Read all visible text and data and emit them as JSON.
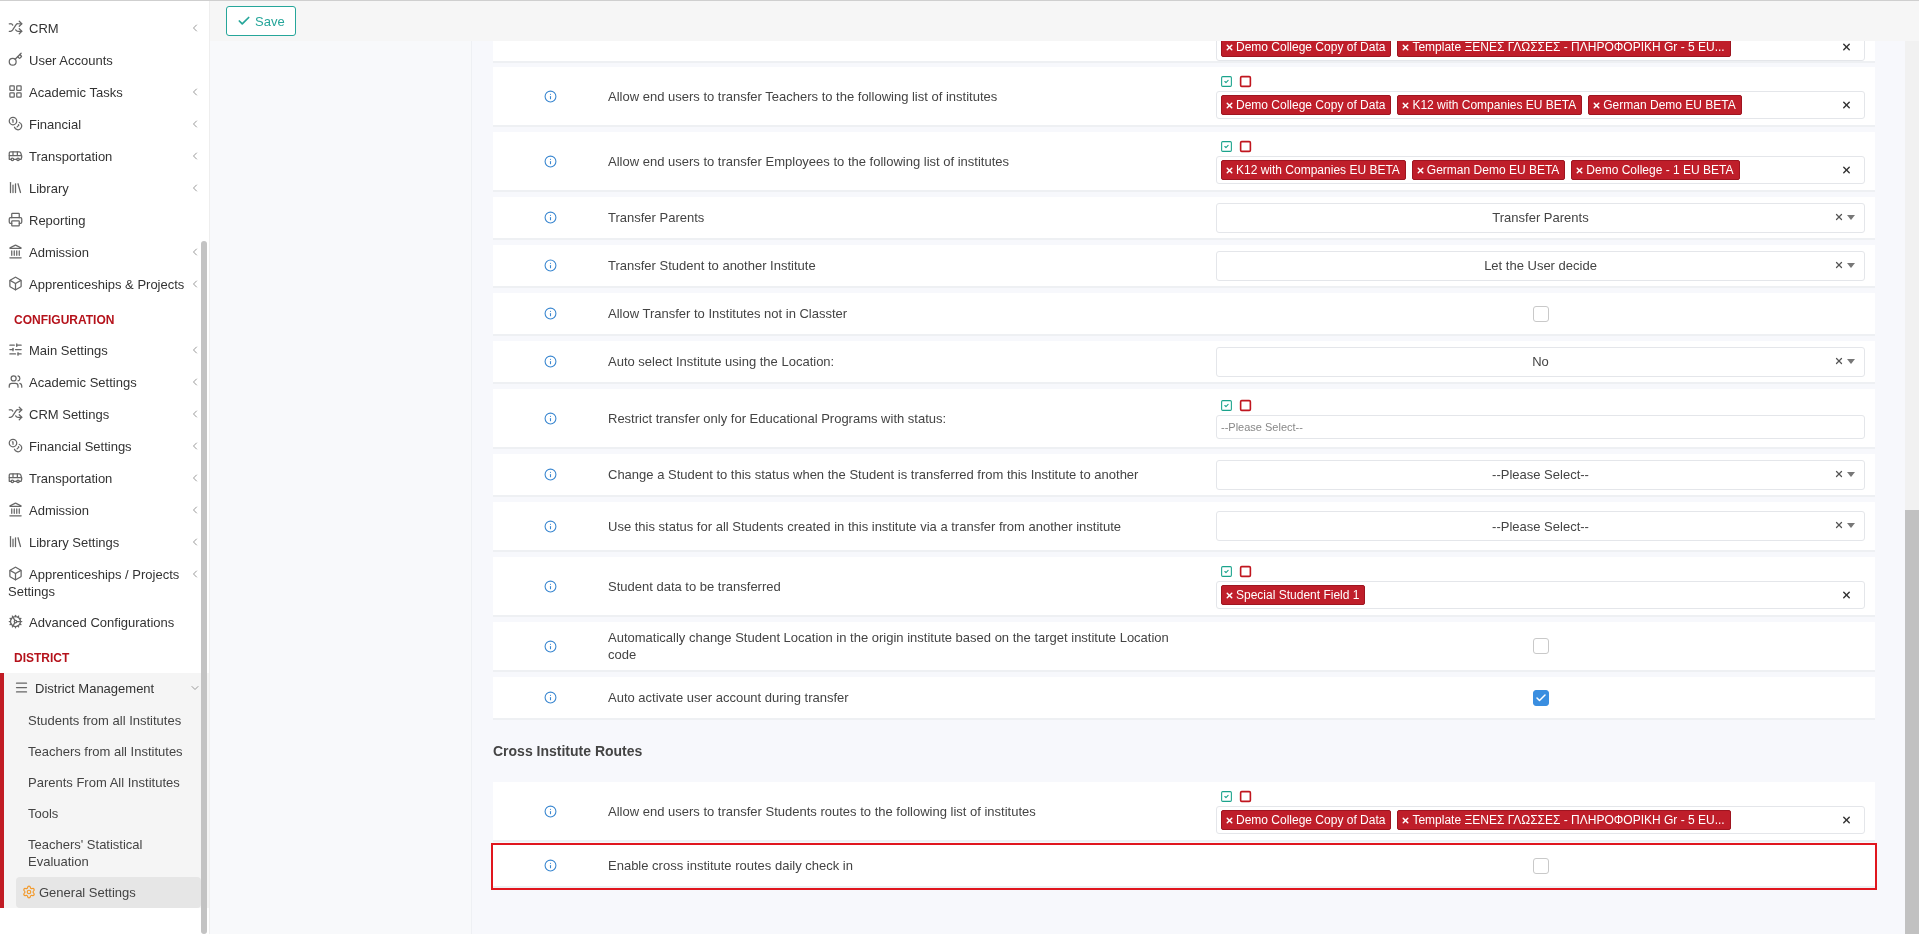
{
  "top_bar": {
    "save_label": "Save"
  },
  "sidebar": {
    "items": [
      {
        "kind": "item",
        "label": "CRM",
        "has_submenu": true
      },
      {
        "kind": "item",
        "label": "User Accounts",
        "has_submenu": false
      },
      {
        "kind": "item",
        "label": "Academic Tasks",
        "has_submenu": true
      },
      {
        "kind": "item",
        "label": "Financial",
        "has_submenu": true
      },
      {
        "kind": "item",
        "label": "Transportation",
        "has_submenu": true
      },
      {
        "kind": "item",
        "label": "Library",
        "has_submenu": true
      },
      {
        "kind": "item",
        "label": "Reporting",
        "has_submenu": false
      },
      {
        "kind": "item",
        "label": "Admission",
        "has_submenu": true
      },
      {
        "kind": "item",
        "label": "Apprenticeships & Projects",
        "has_submenu": true
      },
      {
        "kind": "heading",
        "label": "CONFIGURATION"
      },
      {
        "kind": "item",
        "label": "Main Settings",
        "has_submenu": true
      },
      {
        "kind": "item",
        "label": "Academic Settings",
        "has_submenu": true
      },
      {
        "kind": "item",
        "label": "CRM Settings",
        "has_submenu": true
      },
      {
        "kind": "item",
        "label": "Financial Settings",
        "has_submenu": true
      },
      {
        "kind": "item",
        "label": "Transportation",
        "has_submenu": true
      },
      {
        "kind": "item",
        "label": "Admission",
        "has_submenu": true
      },
      {
        "kind": "item",
        "label": "Library Settings",
        "has_submenu": true
      },
      {
        "kind": "item",
        "label": "Apprenticeships / Projects Settings",
        "has_submenu": true
      },
      {
        "kind": "item",
        "label": "Advanced Configurations",
        "has_submenu": false
      },
      {
        "kind": "heading",
        "label": "DISTRICT"
      },
      {
        "kind": "group",
        "label": "District Management",
        "expanded": true,
        "children": [
          {
            "label": "Students from all Institutes",
            "selected": false
          },
          {
            "label": "Teachers from all Institutes",
            "selected": false
          },
          {
            "label": "Parents From All Institutes",
            "selected": false
          },
          {
            "label": "Tools",
            "selected": false
          },
          {
            "label": "Teachers' Statistical Evaluation",
            "selected": false
          },
          {
            "label": "General Settings",
            "selected": true
          }
        ]
      }
    ]
  },
  "settings": {
    "rows": [
      {
        "kind": "tags",
        "cut_off": true,
        "tags": [
          "Demo College Copy of Data",
          "Template ΞΕΝΕΣ ΓΛΩΣΣΕΣ - ΠΛΗΡΟΦΟΡΙΚΗ Gr - 5 EU..."
        ]
      },
      {
        "kind": "tags",
        "label": "Allow end users to transfer Teachers to the following list of institutes",
        "tags": [
          "Demo College Copy of Data",
          "K12 with Companies EU BETA",
          "German Demo EU BETA"
        ]
      },
      {
        "kind": "tags",
        "label": "Allow end users to transfer Employees to the following list of institutes",
        "tags": [
          "K12 with Companies EU BETA",
          "German Demo EU BETA",
          "Demo College - 1 EU BETA"
        ]
      },
      {
        "kind": "select",
        "label": "Transfer Parents",
        "value": "Transfer Parents"
      },
      {
        "kind": "select",
        "label": "Transfer Student to another Institute",
        "value": "Let the User decide"
      },
      {
        "kind": "checkbox",
        "label": "Allow Transfer to Institutes not in Classter",
        "checked": false
      },
      {
        "kind": "select",
        "label": "Auto select Institute using the Location:",
        "value": "No"
      },
      {
        "kind": "tags",
        "label": "Restrict transfer only for Educational Programs with status:",
        "placeholder": "--Please Select--"
      },
      {
        "kind": "select",
        "label": "Change a Student to this status when the Student is transferred from this Institute to another",
        "value": "--Please Select--"
      },
      {
        "kind": "select",
        "label": "Use this status for all Students created in this institute via a transfer from another institute",
        "value": "--Please Select--"
      },
      {
        "kind": "tags",
        "label": "Student data to be transferred",
        "tags": [
          "Special Student Field 1"
        ]
      },
      {
        "kind": "checkbox",
        "label": "Automatically change Student Location in the origin institute based on the target institute Location code",
        "checked": false
      },
      {
        "kind": "checkbox",
        "label": "Auto activate user account during transfer",
        "checked": true
      }
    ]
  },
  "cross_institute_routes": {
    "heading": "Cross Institute Routes",
    "rows": [
      {
        "kind": "tags",
        "label": "Allow end users to transfer Students routes to the following list of institutes",
        "tags": [
          "Demo College Copy of Data",
          "Template ΞΕΝΕΣ ΓΛΩΣΣΕΣ - ΠΛΗΡΟΦΟΡΙΚΗ Gr - 5 EU..."
        ]
      },
      {
        "kind": "checkbox",
        "label": "Enable cross institute routes daily check in",
        "checked": false,
        "highlighted": true
      }
    ]
  }
}
